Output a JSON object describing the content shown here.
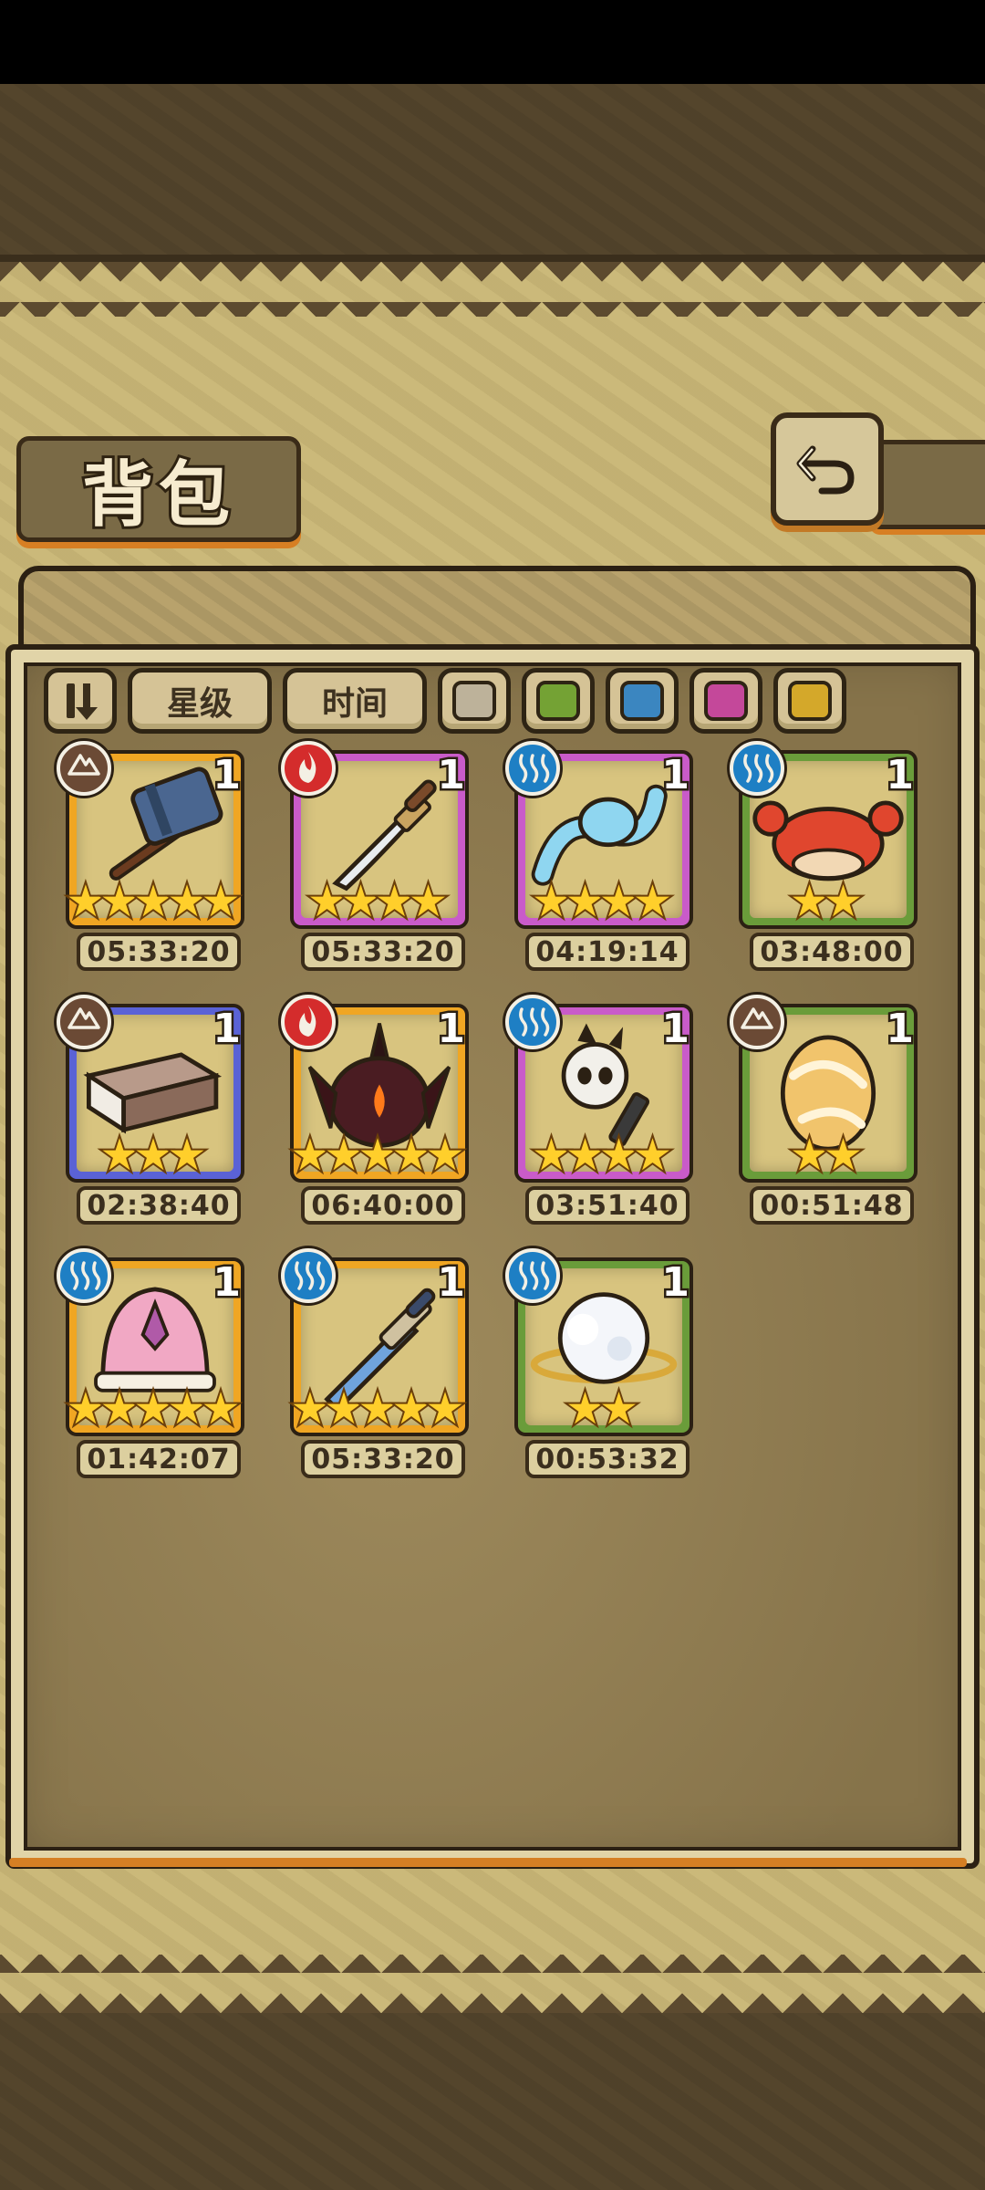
{
  "header": {
    "title": "背包",
    "back_icon": "return-arrow-icon"
  },
  "filters": {
    "sort_icon": "sort-toggle-icon",
    "star_label": "星级",
    "time_label": "时间",
    "colors": [
      "#bdb29a",
      "#74a234",
      "#3b86c0",
      "#c4489a",
      "#d4a82a"
    ]
  },
  "elements": {
    "earth": "#6b4a35",
    "fire": "#d42c2c",
    "water": "#1e7fc4"
  },
  "rarity_colors": {
    "gold": "#f0a623",
    "purple": "#c95bc9",
    "green": "#6a9c3a",
    "blue": "#5a62d6"
  },
  "items": [
    {
      "name": "iron-hammer",
      "element": "earth",
      "rarity": "gold",
      "count": "1",
      "stars": 5,
      "timer": "05:33:20",
      "icon": "hammer-icon"
    },
    {
      "name": "dagger",
      "element": "fire",
      "rarity": "purple",
      "count": "1",
      "stars": 4,
      "timer": "05:33:20",
      "icon": "dagger-icon"
    },
    {
      "name": "water-serpent",
      "element": "water",
      "rarity": "purple",
      "count": "1",
      "stars": 4,
      "timer": "04:19:14",
      "icon": "water-serpent-icon"
    },
    {
      "name": "red-crab",
      "element": "water",
      "rarity": "green",
      "count": "1",
      "stars": 2,
      "timer": "03:48:00",
      "icon": "crab-icon"
    },
    {
      "name": "spell-book",
      "element": "earth",
      "rarity": "blue",
      "count": "1",
      "stars": 3,
      "timer": "02:38:40",
      "icon": "book-icon"
    },
    {
      "name": "demon-helmet",
      "element": "fire",
      "rarity": "gold",
      "count": "1",
      "stars": 5,
      "timer": "06:40:00",
      "icon": "demon-helmet-icon"
    },
    {
      "name": "skull-puppet",
      "element": "water",
      "rarity": "purple",
      "count": "1",
      "stars": 4,
      "timer": "03:51:40",
      "icon": "skull-puppet-icon"
    },
    {
      "name": "golden-egg",
      "element": "earth",
      "rarity": "green",
      "count": "1",
      "stars": 2,
      "timer": "00:51:48",
      "icon": "egg-icon"
    },
    {
      "name": "pink-shell",
      "element": "water",
      "rarity": "gold",
      "count": "1",
      "stars": 5,
      "timer": "01:42:07",
      "icon": "shell-icon"
    },
    {
      "name": "ice-sword",
      "element": "water",
      "rarity": "gold",
      "count": "1",
      "stars": 5,
      "timer": "05:33:20",
      "icon": "sword-icon"
    },
    {
      "name": "cloud-orb",
      "element": "water",
      "rarity": "green",
      "count": "1",
      "stars": 2,
      "timer": "00:53:32",
      "icon": "cloud-orb-icon"
    }
  ]
}
